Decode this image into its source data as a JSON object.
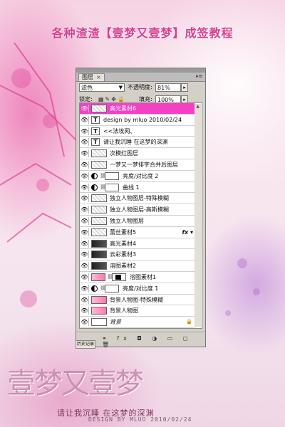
{
  "poster": {
    "title": "各种渣渣【壹梦又壹梦】成签教程",
    "logo_text": "壹梦又壹梦",
    "subtitle": "请让我沉睡  在这梦的深渊",
    "credit": "DESIGN BY MLUO 2010/02/24"
  },
  "panel": {
    "tab_label": "图层",
    "tab_close": "×",
    "menu_glyph": "▸≡",
    "blend_mode": "滤色",
    "opacity_label": "不透明度:",
    "opacity_value": "81%",
    "lock_label": "锁定:",
    "fill_label": "填充:",
    "fill_value": "100%",
    "side_tab": "历史记录",
    "layers": [
      {
        "type": "image",
        "name": "高光素材6",
        "selected": true
      },
      {
        "type": "text",
        "name": "design by mluo 2010/02/24"
      },
      {
        "type": "text",
        "name": "<<法埃网、"
      },
      {
        "type": "text",
        "name": "请让我沉睡 在这梦的深渊"
      },
      {
        "type": "image",
        "name": "次模红图层"
      },
      {
        "type": "image",
        "name": "一梦又一梦排字合并后图层"
      },
      {
        "type": "adjustment",
        "name": "亮度/对比度 2"
      },
      {
        "type": "adjustment",
        "name": "曲线 1"
      },
      {
        "type": "image",
        "name": "独立人物图层-特殊模糊"
      },
      {
        "type": "image",
        "name": "独立人物图层-高斯模糊"
      },
      {
        "type": "image",
        "name": "独立人物图层"
      },
      {
        "type": "image",
        "name": "蕾丝素材5",
        "fx": "fx"
      },
      {
        "type": "image-dark",
        "name": "高光素材4"
      },
      {
        "type": "image-dark",
        "name": "云彩素材3"
      },
      {
        "type": "image-dark",
        "name": "溶图素材2"
      },
      {
        "type": "masked",
        "name": "溶图素材1"
      },
      {
        "type": "adjustment",
        "name": "亮度/对比度 1"
      },
      {
        "type": "image-pink",
        "name": "背景人物图-特殊模糊"
      },
      {
        "type": "image-pink",
        "name": "背景人物图"
      },
      {
        "type": "background",
        "name": "背景",
        "locked": true
      }
    ]
  }
}
